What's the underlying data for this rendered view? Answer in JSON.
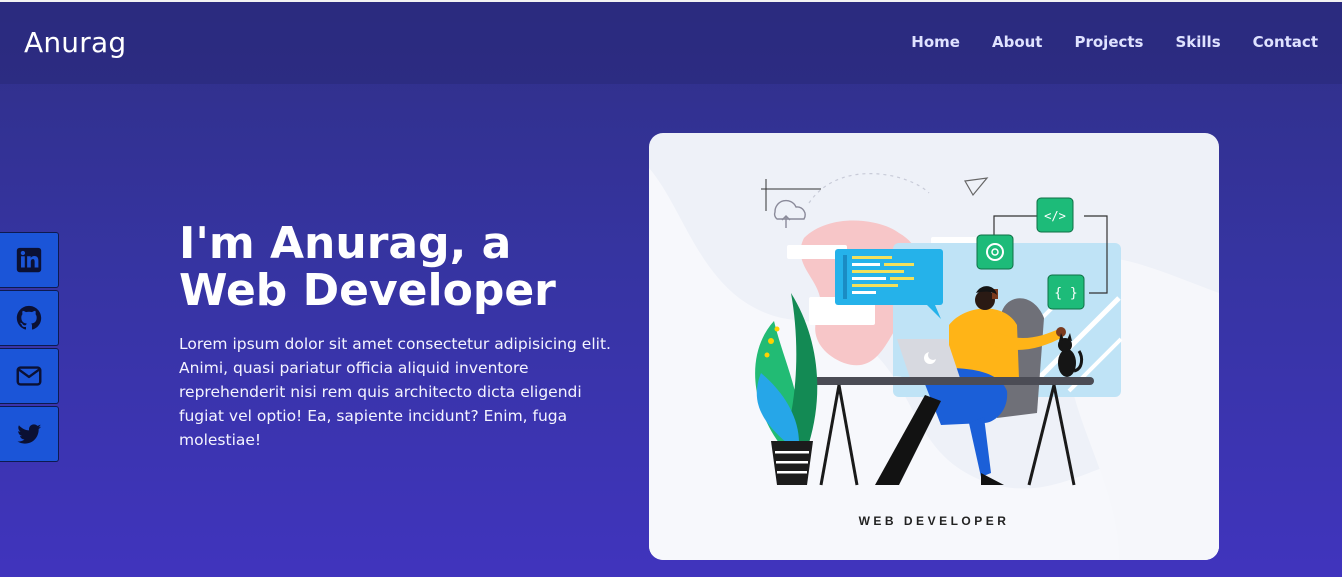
{
  "brand": "Anurag",
  "nav": {
    "items": [
      {
        "label": "Home"
      },
      {
        "label": "About"
      },
      {
        "label": "Projects"
      },
      {
        "label": "Skills"
      },
      {
        "label": "Contact"
      }
    ]
  },
  "social": [
    {
      "icon": "linkedin-icon"
    },
    {
      "icon": "github-icon"
    },
    {
      "icon": "mail-icon"
    },
    {
      "icon": "twitter-icon"
    }
  ],
  "hero": {
    "title": "I'm Anurag, a Web Developer",
    "text": "Lorem ipsum dolor sit amet consectetur adipisicing elit. Animi, quasi pariatur officia aliquid inventore reprehenderit nisi rem quis architecto dicta eligendi fugiat vel optio! Ea, sapiente incidunt? Enim, fuga molestiae!"
  },
  "illustration": {
    "caption": "WEB DEVELOPER"
  },
  "colors": {
    "background_top": "#2f2f86",
    "background_bottom": "#4034bd",
    "social_button": "#1b55d8",
    "nav_text": "#dfe2ff",
    "illustration_bg": "#eef1f8"
  }
}
